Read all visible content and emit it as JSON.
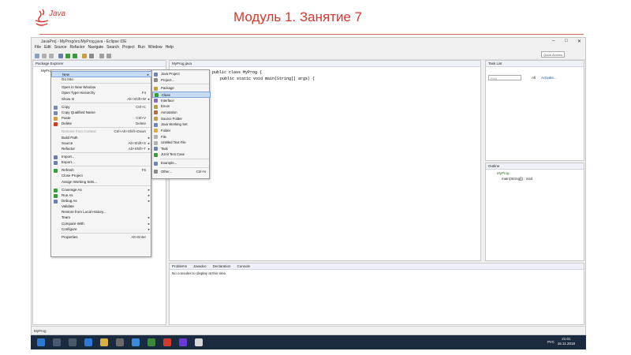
{
  "slide": {
    "title": "Модуль 1. Занятие 7",
    "logo_text": "Java"
  },
  "window": {
    "title": "JavaProj - MyProg/src/MyProg.java - Eclipse IDE"
  },
  "menubar": [
    "File",
    "Edit",
    "Source",
    "Refactor",
    "Navigate",
    "Search",
    "Project",
    "Run",
    "Window",
    "Help"
  ],
  "toolbar": {
    "quick_access": "Quick Access"
  },
  "package_explorer": {
    "title": "Package Explorer",
    "item": "MyProg"
  },
  "editor": {
    "tab": "MyProg.java",
    "line1": "public class MyProg {",
    "line2": "public static void main(String[] args) {"
  },
  "task_list": {
    "title": "Task List",
    "find_placeholder": "Find",
    "all": "All",
    "activate": "Activate..."
  },
  "outline": {
    "title": "Outline",
    "cls": "MyProg",
    "method": "main(String[]) : void"
  },
  "console": {
    "tabs": [
      "Problems",
      "Javadoc",
      "Declaration",
      "Console"
    ],
    "message": "No consoles to display at this time."
  },
  "status_bar": "MyProg",
  "context_menu": [
    {
      "label": "New",
      "shortcut": "",
      "arrow": "▸",
      "selected": true,
      "icon": ""
    },
    {
      "label": "Go Into",
      "shortcut": "",
      "arrow": "",
      "icon": ""
    },
    {
      "sep": true
    },
    {
      "label": "Open in New Window",
      "shortcut": "",
      "arrow": "",
      "icon": ""
    },
    {
      "label": "Open Type Hierarchy",
      "shortcut": "F4",
      "arrow": "",
      "icon": ""
    },
    {
      "label": "Show In",
      "shortcut": "Alt+Shift+W",
      "arrow": "▸",
      "icon": ""
    },
    {
      "sep": true
    },
    {
      "label": "Copy",
      "shortcut": "Ctrl+C",
      "arrow": "",
      "icon": "#7a8aa8"
    },
    {
      "label": "Copy Qualified Name",
      "shortcut": "",
      "arrow": "",
      "icon": "#7a8aa8"
    },
    {
      "label": "Paste",
      "shortcut": "Ctrl+V",
      "arrow": "",
      "icon": "#c9a048"
    },
    {
      "label": "Delete",
      "shortcut": "Delete",
      "arrow": "",
      "icon": "#d23a2a"
    },
    {
      "sep": true
    },
    {
      "label": "Remove from Context",
      "shortcut": "Ctrl+Alt+Shift+Down",
      "arrow": "",
      "icon": "",
      "disabled": true
    },
    {
      "label": "Build Path",
      "shortcut": "",
      "arrow": "▸",
      "icon": ""
    },
    {
      "label": "Source",
      "shortcut": "Alt+Shift+S",
      "arrow": "▸",
      "icon": ""
    },
    {
      "label": "Refactor",
      "shortcut": "Alt+Shift+T",
      "arrow": "▸",
      "icon": ""
    },
    {
      "sep": true
    },
    {
      "label": "Import...",
      "shortcut": "",
      "arrow": "",
      "icon": "#6c7fa6"
    },
    {
      "label": "Export...",
      "shortcut": "",
      "arrow": "",
      "icon": "#6c7fa6"
    },
    {
      "sep": true
    },
    {
      "label": "Refresh",
      "shortcut": "F5",
      "arrow": "",
      "icon": "#3b9a3b"
    },
    {
      "label": "Close Project",
      "shortcut": "",
      "arrow": "",
      "icon": ""
    },
    {
      "label": "Assign Working Sets...",
      "shortcut": "",
      "arrow": "",
      "icon": ""
    },
    {
      "sep": true
    },
    {
      "label": "Coverage As",
      "shortcut": "",
      "arrow": "▸",
      "icon": "#3b9a3b"
    },
    {
      "label": "Run As",
      "shortcut": "",
      "arrow": "▸",
      "icon": "#3b9a3b"
    },
    {
      "label": "Debug As",
      "shortcut": "",
      "arrow": "▸",
      "icon": "#6a7fb0"
    },
    {
      "label": "Validate",
      "shortcut": "",
      "arrow": "",
      "icon": ""
    },
    {
      "label": "Restore from Local History...",
      "shortcut": "",
      "arrow": "",
      "icon": ""
    },
    {
      "label": "Team",
      "shortcut": "",
      "arrow": "▸",
      "icon": ""
    },
    {
      "label": "Compare With",
      "shortcut": "",
      "arrow": "▸",
      "icon": ""
    },
    {
      "label": "Configure",
      "shortcut": "",
      "arrow": "▸",
      "icon": ""
    },
    {
      "sep": true
    },
    {
      "label": "Properties",
      "shortcut": "Alt+Enter",
      "arrow": "",
      "icon": ""
    }
  ],
  "new_submenu": [
    {
      "label": "Java Project",
      "shortcut": "",
      "icon": "#6a86b8"
    },
    {
      "label": "Project...",
      "shortcut": "",
      "icon": "#8a8a8a"
    },
    {
      "sep": true
    },
    {
      "label": "Package",
      "shortcut": "",
      "icon": "#c4a040"
    },
    {
      "label": "Class",
      "shortcut": "",
      "icon": "#3b9a3b",
      "selected": true
    },
    {
      "label": "Interface",
      "shortcut": "",
      "icon": "#8a6ab8"
    },
    {
      "label": "Enum",
      "shortcut": "",
      "icon": "#b8a040"
    },
    {
      "label": "Annotation",
      "shortcut": "",
      "icon": "#b06a3b"
    },
    {
      "label": "Source Folder",
      "shortcut": "",
      "icon": "#c4a040"
    },
    {
      "label": "Java Working Set",
      "shortcut": "",
      "icon": "#6a86b8"
    },
    {
      "label": "Folder",
      "shortcut": "",
      "icon": "#d8b040"
    },
    {
      "label": "File",
      "shortcut": "",
      "icon": "#b0b0b0"
    },
    {
      "label": "Untitled Text File",
      "shortcut": "",
      "icon": "#b0b0b0"
    },
    {
      "label": "Task",
      "shortcut": "",
      "icon": "#6a86b8"
    },
    {
      "label": "JUnit Test Case",
      "shortcut": "",
      "icon": "#3b9a3b"
    },
    {
      "sep": true
    },
    {
      "label": "Example...",
      "shortcut": "",
      "icon": "#6a86b8"
    },
    {
      "sep": true
    },
    {
      "label": "Other...",
      "shortcut": "Ctrl+N",
      "icon": "#8a8a8a"
    }
  ],
  "taskbar": {
    "lang": "РУС",
    "time": "21:01",
    "date": "16.11.2018"
  }
}
